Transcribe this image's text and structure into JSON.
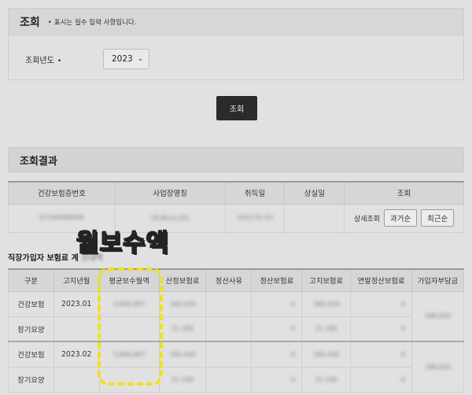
{
  "search": {
    "title": "조회",
    "required_note": "표시는 필수 입력 사항입니다.",
    "year_label": "조회년도",
    "required_mark": "•",
    "year_value": "2023",
    "button_label": "조회"
  },
  "result": {
    "title": "조회결과",
    "columns": [
      "건강보험증번호",
      "사업장명칭",
      "취득일",
      "상실일",
      "조회"
    ],
    "row": {
      "card_no": "07100090658",
      "workplace": "(주)회사소프트",
      "acquired": "2022.01.03",
      "lost": "",
      "detail_label": "상세조회",
      "btn_past": "과거순",
      "btn_recent": "최근순"
    }
  },
  "insurance": {
    "label": "직장가입자 보험료 계",
    "label_blurred": "산내역"
  },
  "detail_table": {
    "columns": [
      "구분",
      "고지년월",
      "평균보수월액",
      "산정보험료",
      "정산사유",
      "정산보험료",
      "고지보험료",
      "연말정산보험료",
      "가입자부담금"
    ],
    "rows": [
      {
        "kind": "건강보험",
        "month": "2023.01",
        "avg": "3,000,007",
        "calc": "165,430",
        "reason": "",
        "settle": "0",
        "notice": "165,430",
        "yearend": "0",
        "share": "186,620"
      },
      {
        "kind": "장기요양",
        "month": "",
        "avg": "",
        "calc": "21,190",
        "reason": "",
        "settle": "0",
        "notice": "21,190",
        "yearend": "0",
        "share": ""
      },
      {
        "kind": "건강보험",
        "month": "2023.02",
        "avg": "3,000,007",
        "calc": "165,430",
        "reason": "",
        "settle": "0",
        "notice": "165,430",
        "yearend": "0",
        "share": "186,620"
      },
      {
        "kind": "장기요양",
        "month": "",
        "avg": "",
        "calc": "21,190",
        "reason": "",
        "settle": "0",
        "notice": "21,190",
        "yearend": "0",
        "share": ""
      }
    ]
  },
  "callout": {
    "text": "월보수액",
    "color": "#f5e020"
  }
}
